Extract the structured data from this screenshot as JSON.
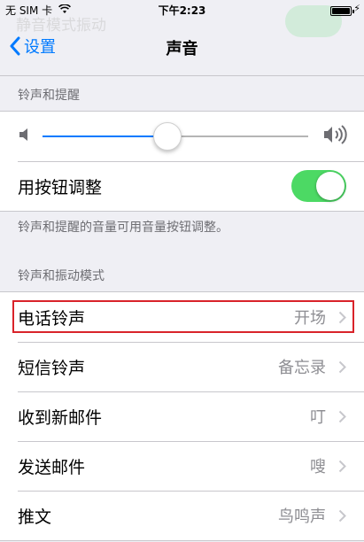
{
  "status_bar": {
    "carrier": "无 SIM 卡",
    "time": "下午2:23",
    "wifi_icon": "wifi-icon",
    "battery_icon": "battery-icon",
    "charging_icon": "lightning-icon"
  },
  "ghost_row": {
    "label": "静音模式振动"
  },
  "nav": {
    "back_label": "设置",
    "back_icon": "chevron-left-icon",
    "title": "声音"
  },
  "ringer_section": {
    "header": "铃声和提醒",
    "volume_level": 0.47,
    "change_with_buttons_label": "用按钮调整",
    "change_with_buttons_on": true,
    "footer": "铃声和提醒的音量可用音量按钮调整。"
  },
  "patterns_section": {
    "header": "铃声和振动模式",
    "rows": [
      {
        "label": "电话铃声",
        "value": "开场"
      },
      {
        "label": "短信铃声",
        "value": "备忘录"
      },
      {
        "label": "收到新邮件",
        "value": "叮"
      },
      {
        "label": "发送邮件",
        "value": "嗖"
      },
      {
        "label": "推文",
        "value": "鸟鸣声"
      }
    ]
  },
  "colors": {
    "accent": "#007aff",
    "toggle_on": "#4cd964",
    "highlight": "#d9232a",
    "background": "#efeff4"
  }
}
